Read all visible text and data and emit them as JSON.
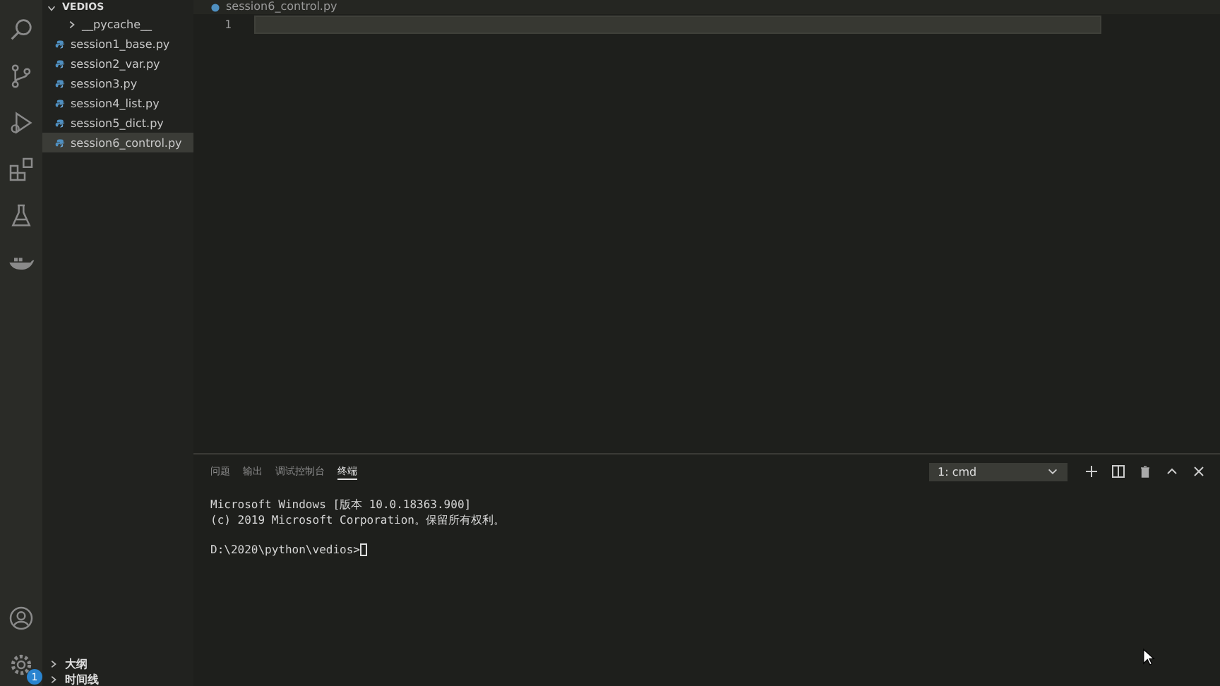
{
  "explorer": {
    "folder": "VEDIOS",
    "expanded": true,
    "items": [
      {
        "kind": "folder",
        "name": "__pycache__",
        "expanded": false,
        "selected": false
      },
      {
        "kind": "file",
        "name": "session1_base.py",
        "selected": false
      },
      {
        "kind": "file",
        "name": "session2_var.py",
        "selected": false
      },
      {
        "kind": "file",
        "name": "session3.py",
        "selected": false
      },
      {
        "kind": "file",
        "name": "session4_list.py",
        "selected": false
      },
      {
        "kind": "file",
        "name": "session5_dict.py",
        "selected": false
      },
      {
        "kind": "file",
        "name": "session6_control.py",
        "selected": true
      }
    ]
  },
  "sections": [
    {
      "label": "大纲",
      "expanded": false
    },
    {
      "label": "时间线",
      "expanded": false
    }
  ],
  "settings_badge": "1",
  "editor": {
    "tab": "session6_control.py",
    "line_numbers": [
      "1"
    ]
  },
  "panel": {
    "tabs": [
      {
        "label": "问题",
        "selected": false
      },
      {
        "label": "输出",
        "selected": false
      },
      {
        "label": "调试控制台",
        "selected": false
      },
      {
        "label": "终端",
        "selected": true
      }
    ],
    "terminal_select": "1: cmd",
    "terminal_blocks": [
      [
        "Microsoft Windows [版本 10.0.18363.900]",
        "(c) 2019 Microsoft Corporation。保留所有权利。"
      ],
      [
        "D:\\2020\\python\\vedios>"
      ]
    ]
  }
}
